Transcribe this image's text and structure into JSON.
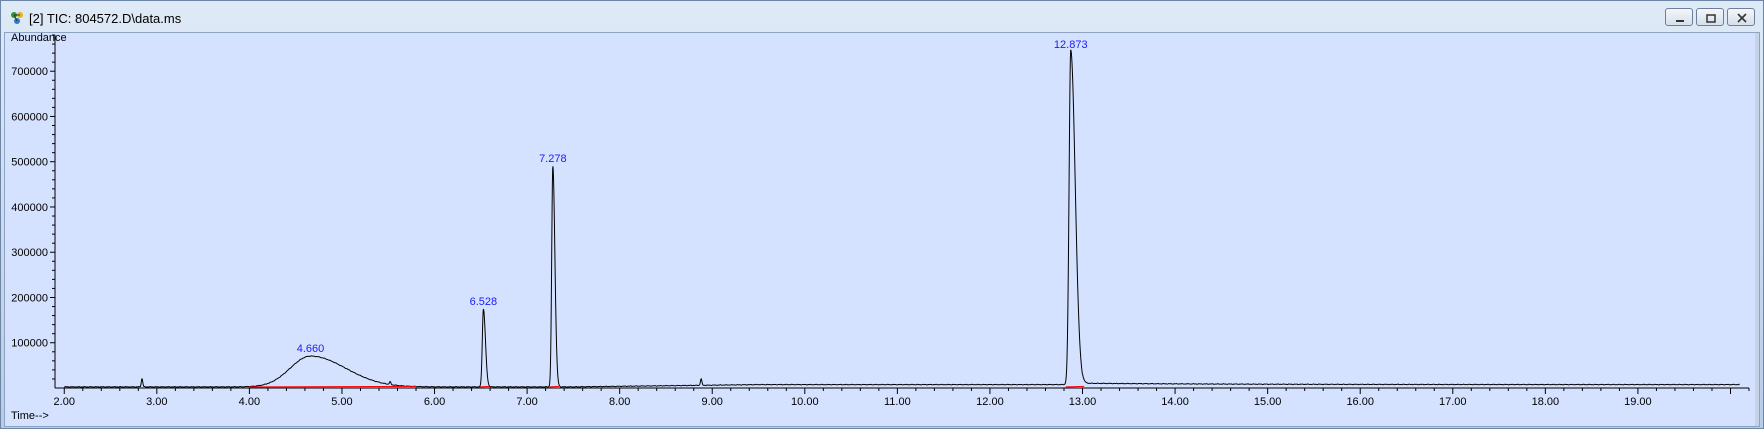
{
  "window": {
    "title": "[2] TIC: 804572.D\\data.ms",
    "icon": "chemstation-molecule-icon",
    "buttons": [
      "minimize",
      "restore",
      "close"
    ]
  },
  "chart_data": {
    "type": "line",
    "ylabel": "Abundance",
    "xlabel": "Time-->",
    "xlim": [
      1.9,
      20.2
    ],
    "ylim": [
      0,
      780000
    ],
    "x_ticks": [
      "2.00",
      "3.00",
      "4.00",
      "5.00",
      "6.00",
      "7.00",
      "8.00",
      "9.00",
      "10.00",
      "11.00",
      "12.00",
      "13.00",
      "14.00",
      "15.00",
      "16.00",
      "17.00",
      "18.00",
      "19.00"
    ],
    "y_ticks": [
      "100000",
      "200000",
      "300000",
      "400000",
      "500000",
      "600000",
      "700000"
    ],
    "line_color": "#000000",
    "baseline_color": "#ff0000",
    "peaks": [
      {
        "rt": 4.66,
        "label": "4.660",
        "height": 68000,
        "width": 0.22,
        "tail": 0.16
      },
      {
        "rt": 6.528,
        "label": "6.528",
        "height": 172000,
        "width": 0.012,
        "tail": 0.01
      },
      {
        "rt": 7.278,
        "label": "7.278",
        "height": 488000,
        "width": 0.012,
        "tail": 0.01
      },
      {
        "rt": 12.873,
        "label": "12.873",
        "height": 740000,
        "width": 0.018,
        "tail": 0.03
      }
    ],
    "minor_peaks": [
      {
        "rt": 2.84,
        "height": 18000
      },
      {
        "rt": 5.52,
        "height": 6000
      },
      {
        "rt": 8.88,
        "height": 14000
      }
    ]
  }
}
